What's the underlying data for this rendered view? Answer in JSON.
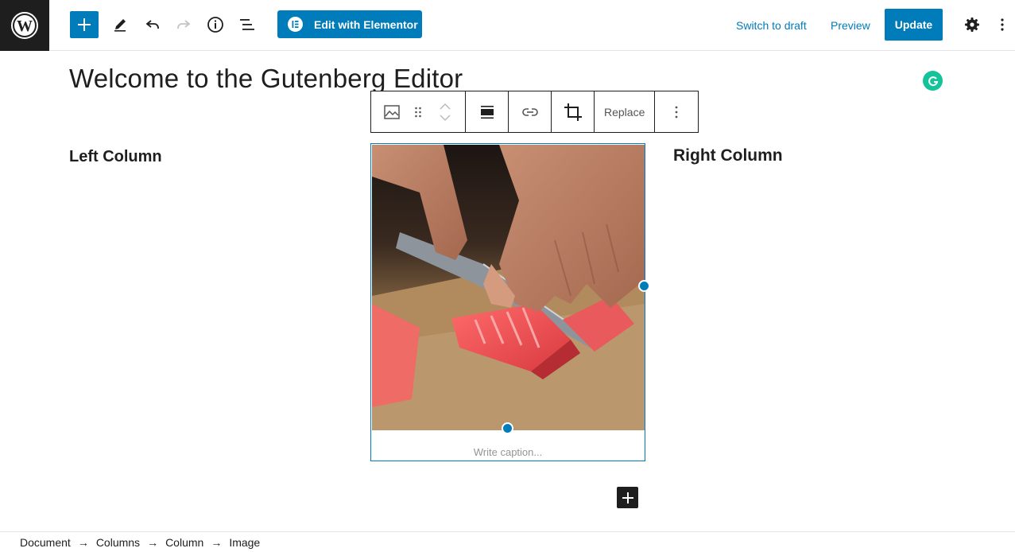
{
  "toolbar": {
    "elementor_label": "Edit with Elementor",
    "switch_to_draft": "Switch to draft",
    "preview": "Preview",
    "update": "Update",
    "icons": [
      "wordpress-logo",
      "plus-icon",
      "pen-icon",
      "undo-icon",
      "redo-icon",
      "info-icon",
      "list-view-icon",
      "elementor-icon",
      "gear-icon",
      "more-vertical-icon"
    ]
  },
  "post": {
    "title": "Welcome to the Gutenberg Editor"
  },
  "block_toolbar": {
    "replace_label": "Replace",
    "icons": [
      "image-icon",
      "drag-handle-icon",
      "move-up-icon",
      "move-down-icon",
      "align-icon",
      "link-icon",
      "crop-icon",
      "more-vertical-icon"
    ]
  },
  "columns": {
    "left_heading": "Left Column",
    "right_heading": "Right Column"
  },
  "image_block": {
    "caption_placeholder": "Write caption..."
  },
  "breadcrumb": {
    "items": [
      "Document",
      "Columns",
      "Column",
      "Image"
    ],
    "separator": "→"
  },
  "colors": {
    "accent": "#007cba",
    "dark": "#1e1e1e",
    "grammarly": "#15c39a"
  }
}
